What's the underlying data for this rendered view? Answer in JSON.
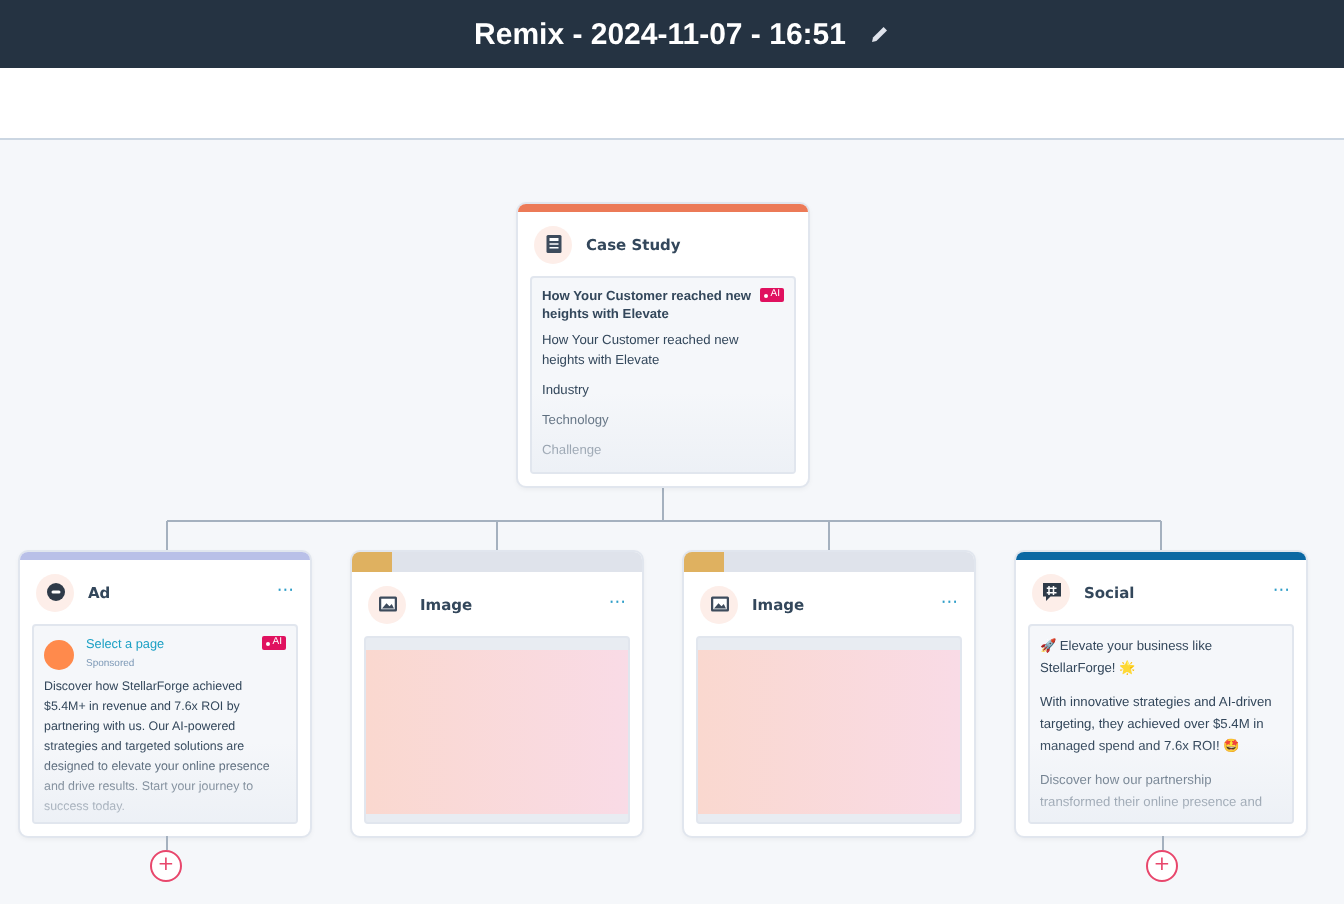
{
  "header": {
    "title": "Remix - 2024-11-07 - 16:51"
  },
  "root": {
    "kind": "case_study",
    "title": "Case Study",
    "color": "#ec7a57",
    "preview": {
      "headline": "How Your Customer reached new heights with Elevate",
      "badge": "AI",
      "lines": [
        "How Your Customer reached new heights with Elevate",
        "Industry",
        "Technology",
        "Challenge"
      ]
    }
  },
  "children": [
    {
      "kind": "ad",
      "title": "Ad",
      "menu": "···",
      "color": "#b9c0e8",
      "preview": {
        "link": "Select a page",
        "badge": "AI",
        "sponsor": "Sponsored",
        "body": "Discover how StellarForge achieved $5.4M+ in revenue and 7.6x ROI by partnering with us. Our AI-powered strategies and targeted solutions are designed to elevate your online presence and drive results. Start your journey to success today."
      },
      "add": "+"
    },
    {
      "kind": "image",
      "title": "Image",
      "menu": "···",
      "color": "#dfb160"
    },
    {
      "kind": "image",
      "title": "Image",
      "menu": "···",
      "color": "#dfb160"
    },
    {
      "kind": "social",
      "title": "Social",
      "menu": "···",
      "color": "#0b68a3",
      "preview": {
        "paragraphs": [
          "🚀 Elevate your business like StellarForge! 🌟",
          "With innovative strategies and AI-driven targeting, they achieved over $5.4M in managed spend and 7.6x ROI! 🤩",
          "Discover how our partnership transformed their online presence and"
        ]
      },
      "add": "+"
    }
  ]
}
